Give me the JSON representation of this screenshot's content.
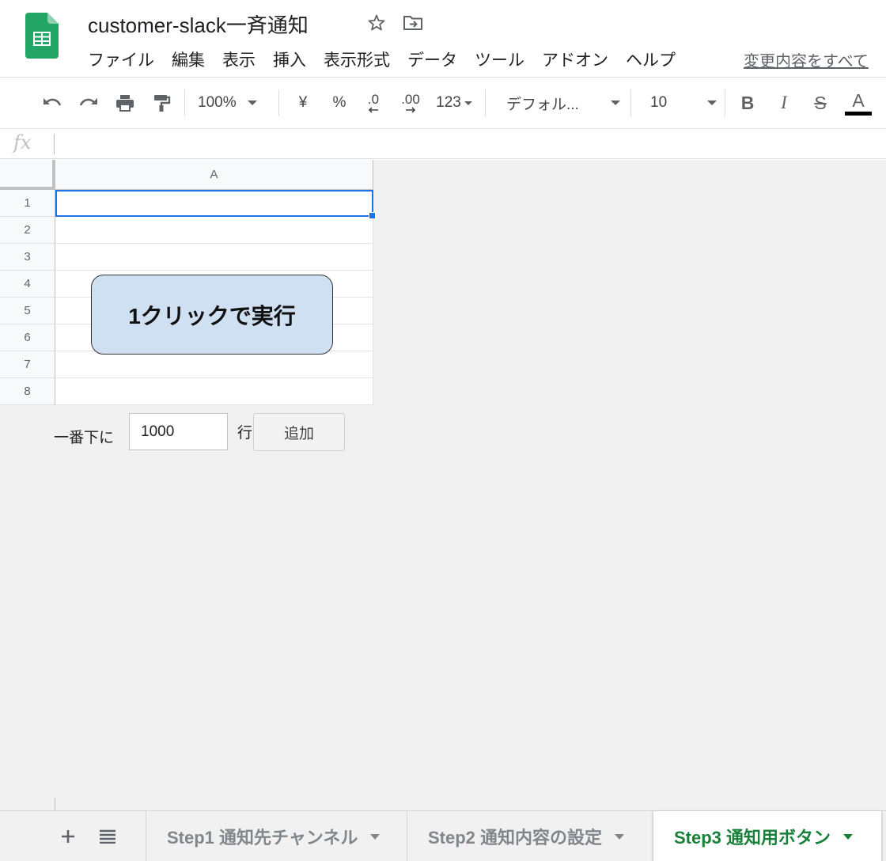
{
  "document": {
    "title": "customer-slack一斉通知",
    "star_icon": "star-icon",
    "move_icon": "move-to-folder-icon"
  },
  "menu": {
    "items": [
      "ファイル",
      "編集",
      "表示",
      "挿入",
      "表示形式",
      "データ",
      "ツール",
      "アドオン",
      "ヘルプ"
    ],
    "changes_link": "変更内容をすべて"
  },
  "toolbar": {
    "zoom": "100%",
    "currency": "¥",
    "percent": "%",
    "decimal_decrease": ".0",
    "decimal_increase": ".00",
    "more_formats": "123",
    "font_family": "デフォル...",
    "font_size": "10",
    "bold": "B",
    "italic": "I",
    "strikethrough": "S",
    "text_color": "A",
    "text_color_value": "#000000"
  },
  "formula_bar": {
    "fx_label": "fx",
    "value": ""
  },
  "grid": {
    "column_header": "A",
    "row_numbers": [
      "1",
      "2",
      "3",
      "4",
      "5",
      "6",
      "7",
      "8"
    ],
    "selected_cell": "A1",
    "drawing_button_label": "1クリックで実行"
  },
  "add_rows": {
    "label": "一番下に",
    "value": "1000",
    "suffix": "行",
    "button_label": "追加"
  },
  "sheet_tabs": {
    "tabs": [
      {
        "label": "Step1 通知先チャンネル",
        "active": false
      },
      {
        "label": "Step2 通知内容の設定",
        "active": false
      },
      {
        "label": "Step3 通知用ボタン",
        "active": true
      }
    ],
    "active_color": "#188038"
  }
}
